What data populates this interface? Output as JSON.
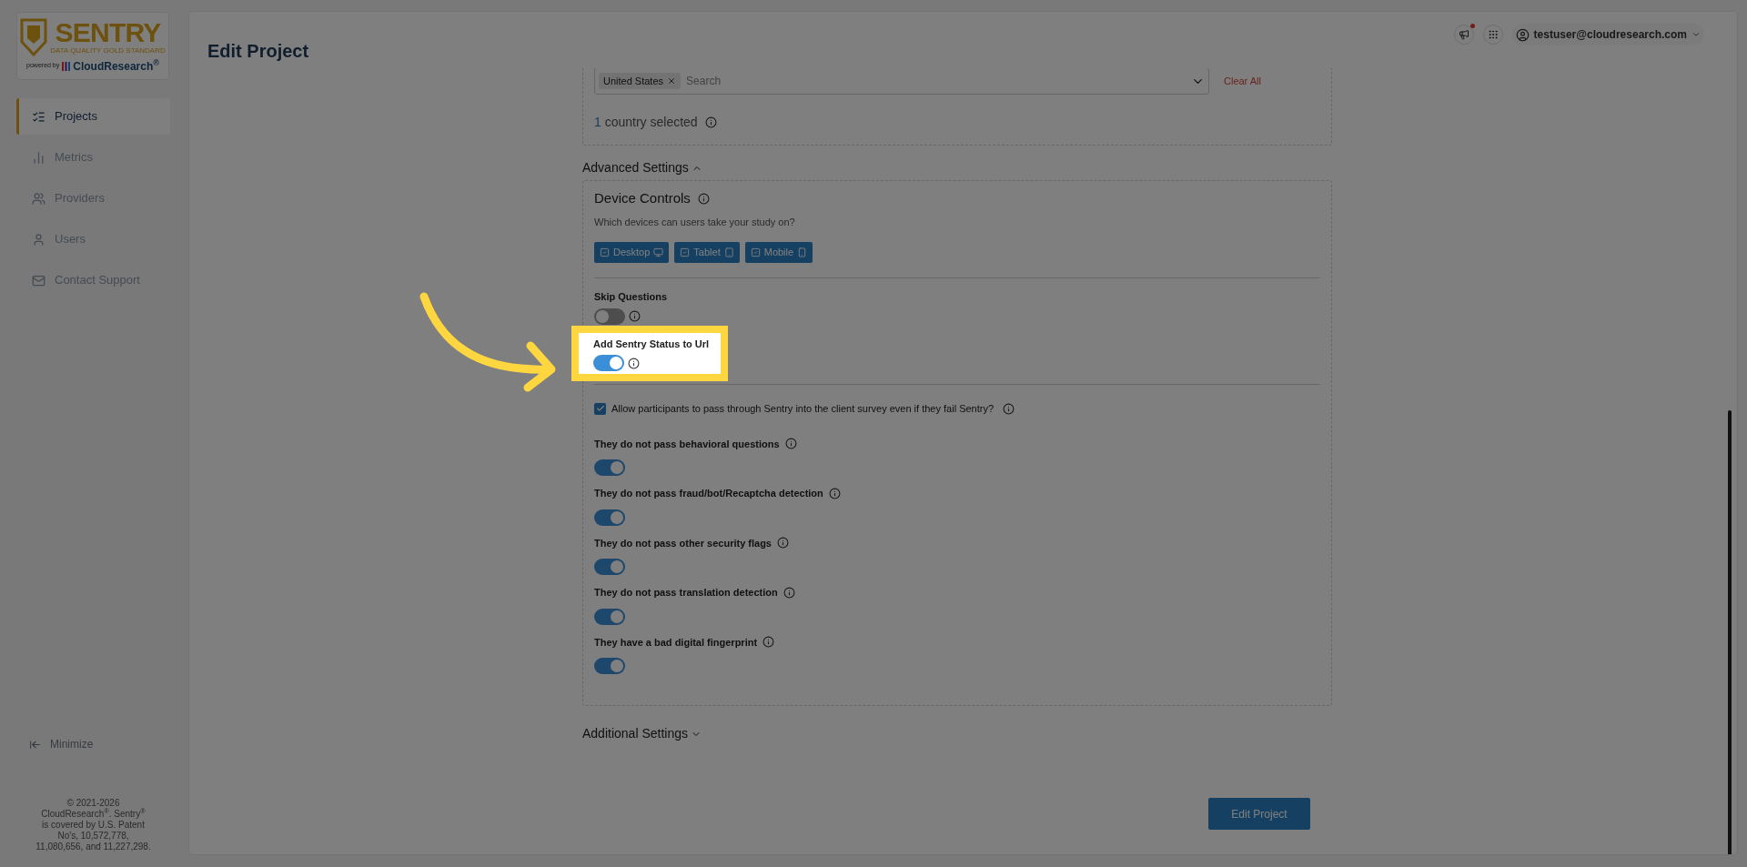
{
  "sidebar": {
    "logo": {
      "title": "SENTRY",
      "tagline": "DATA QUALITY GOLD STANDARD",
      "powered_by": "powered by",
      "brand": "CloudResearch$^{®}$"
    },
    "items": [
      {
        "label": "Projects",
        "kind": "projects",
        "selected": true
      },
      {
        "label": "Metrics",
        "kind": "metrics",
        "selected": false
      },
      {
        "label": "Providers",
        "kind": "providers",
        "selected": false
      },
      {
        "label": "Users",
        "kind": "users",
        "selected": false
      },
      {
        "label": "Contact Support",
        "kind": "support",
        "selected": false
      }
    ],
    "minimize": "Minimize",
    "footer": "© 2021-2026\nCloudResearch$^{®}$. Sentry$^{®}$\nis covered by U.S. Patent\nNo's, 10,572,778,\n11,080,656, and 11,227,298."
  },
  "header": {
    "title": "Edit Project",
    "unread": true,
    "user_email": "testuser@cloudresearch.com"
  },
  "countries": {
    "chip": "United States",
    "placeholder": "Search",
    "clear_all": "Clear All",
    "count": "1",
    "count_label": "country selected"
  },
  "advanced": {
    "title": "Advanced Settings",
    "expanded": true,
    "device_controls": {
      "title": "Device Controls",
      "subtitle": "Which devices can users take your study on?",
      "devices": [
        {
          "label": "Desktop",
          "kind": "desktop",
          "checked": true
        },
        {
          "label": "Tablet",
          "kind": "tablet",
          "checked": true
        },
        {
          "label": "Mobile",
          "kind": "mobile",
          "checked": true
        }
      ]
    },
    "skip_questions": {
      "label": "Skip Questions",
      "on": false
    },
    "sentry_status": {
      "label": "Add Sentry Status to Url",
      "on": true,
      "highlighted": true
    },
    "pass_through": {
      "label": "Allow participants to pass through Sentry into the client survey even if they fail Sentry?",
      "checked": true
    },
    "fail_rules": [
      {
        "label": "They do not pass behavioral questions",
        "on": true
      },
      {
        "label": "They do not pass fraud/bot/Recaptcha detection",
        "on": true
      },
      {
        "label": "They do not pass other security flags",
        "on": true
      },
      {
        "label": "They do not pass translation detection",
        "on": true
      },
      {
        "label": "They have a bad digital fingerprint",
        "on": true
      }
    ]
  },
  "additional": {
    "title": "Additional Settings",
    "expanded": false
  },
  "submit": "Edit Project"
}
